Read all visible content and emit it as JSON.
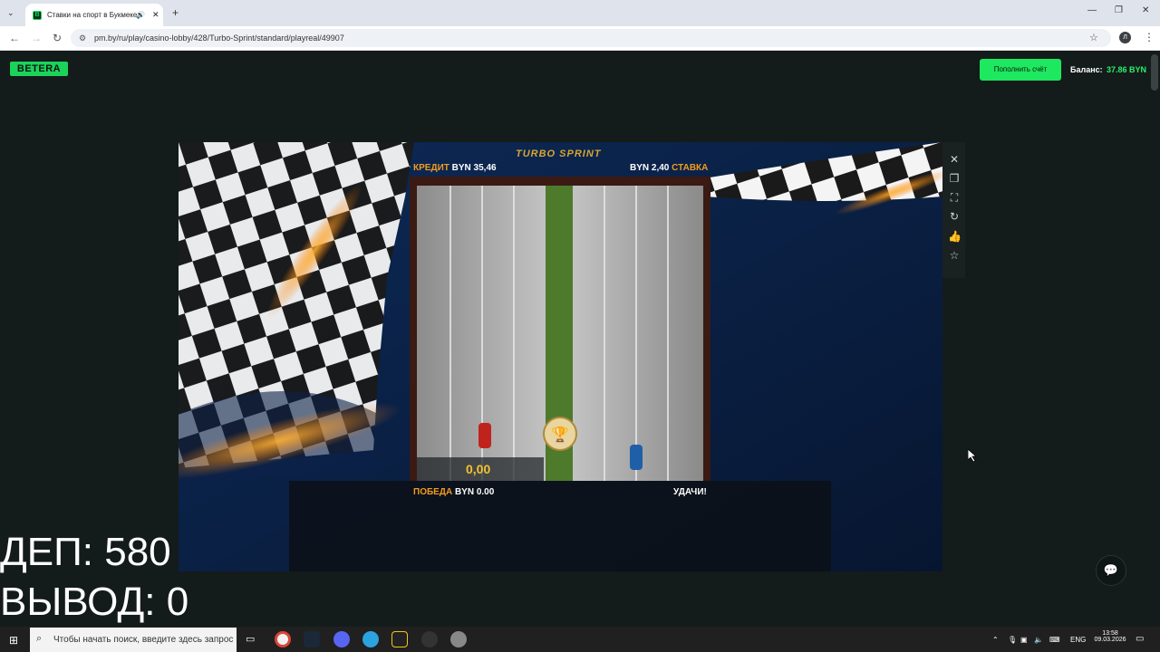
{
  "browser": {
    "tab_title": "Ставки на спорт в Букмеке",
    "url": "pm.by/ru/play/casino-lobby/428/Turbo-Sprint/standard/playreal/49907",
    "profile_initial": "Л"
  },
  "site": {
    "logo": "BETERA",
    "deposit_button": "Пополнить счёт",
    "balance_label": "Баланс:",
    "balance_value": "37.86 BYN"
  },
  "game": {
    "title": "TURBO SPRINT",
    "credit_label": "КРЕДИТ",
    "credit_value": "BYN 35,46",
    "bet_value": "BYN 2,40",
    "bet_label": "СТАВКА",
    "win_label": "ПОБЕДА",
    "win_value": "BYN 0.00",
    "good_luck": "УДАЧИ!",
    "win_counter": "0,00"
  },
  "overlay": {
    "deposit_line": "ДЕП: 580",
    "withdraw_line": "ВЫВОД: 0"
  },
  "taskbar": {
    "search_placeholder": "Чтобы начать поиск, введите здесь запрос",
    "lang": "ENG",
    "time": "13:58",
    "date": "09.03.2026"
  },
  "colors": {
    "accent_green": "#1ee85f",
    "hud_orange": "#f39b1c",
    "page_bg": "#141b1b"
  }
}
